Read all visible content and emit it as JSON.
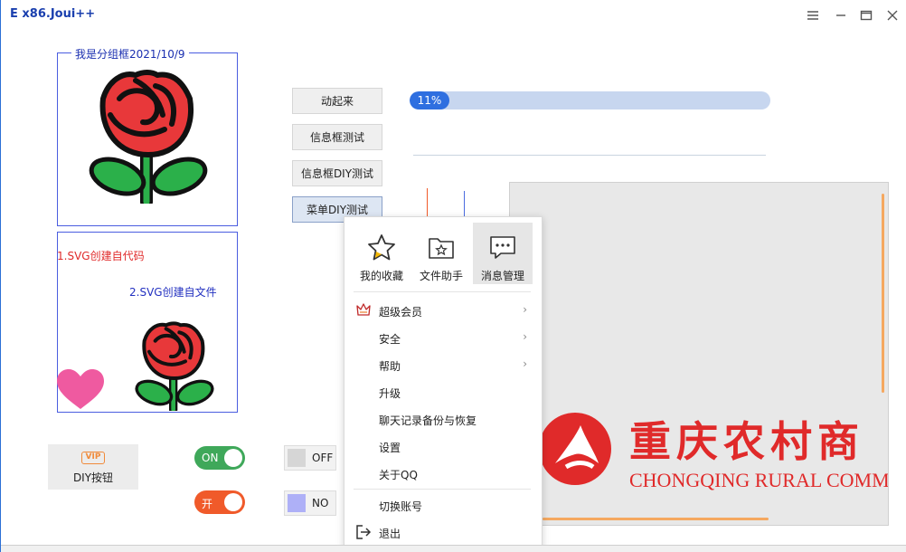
{
  "window": {
    "title": "E x86.Joui++"
  },
  "group": {
    "label": "我是分组框2021/10/9"
  },
  "svg_labels": {
    "code": "1.SVG创建自代码",
    "file": "2.SVG创建自文件"
  },
  "buttons": {
    "animate": "动起来",
    "msgbox": "信息框测试",
    "msgbox_diy": "信息框DIY测试",
    "menu_diy": "菜单DIY测试"
  },
  "progress": {
    "percent": 11,
    "text": "11%"
  },
  "menu": {
    "top": [
      {
        "label": "我的收藏",
        "icon": "star-icon"
      },
      {
        "label": "文件助手",
        "icon": "folder-star-icon"
      },
      {
        "label": "消息管理",
        "icon": "message-icon"
      }
    ],
    "items": [
      {
        "label": "超级会员",
        "submenu": true,
        "icon": "crown-icon"
      },
      {
        "label": "安全",
        "submenu": true
      },
      {
        "label": "帮助",
        "submenu": true
      },
      {
        "label": "升级",
        "submenu": false
      },
      {
        "label": "聊天记录备份与恢复",
        "submenu": false
      },
      {
        "label": "设置",
        "submenu": false
      },
      {
        "label": "关于QQ",
        "submenu": false
      },
      {
        "label": "切换账号",
        "submenu": false
      },
      {
        "label": "退出",
        "submenu": false,
        "icon": "exit-icon"
      }
    ]
  },
  "diy_button": {
    "label": "DIY按钮",
    "badge": "VIP"
  },
  "toggles": [
    {
      "label": "ON",
      "color": "#3fa85a"
    },
    {
      "label": "开",
      "color": "#f05a2a"
    }
  ],
  "checks": [
    {
      "label": "OFF",
      "color": "#d6d6d6"
    },
    {
      "label": "NO",
      "color": "#aeb0f7"
    }
  ],
  "banner": {
    "cn": "重庆农村商",
    "en": "CHONGQING RURAL COMM",
    "color": "#e02a2a"
  }
}
